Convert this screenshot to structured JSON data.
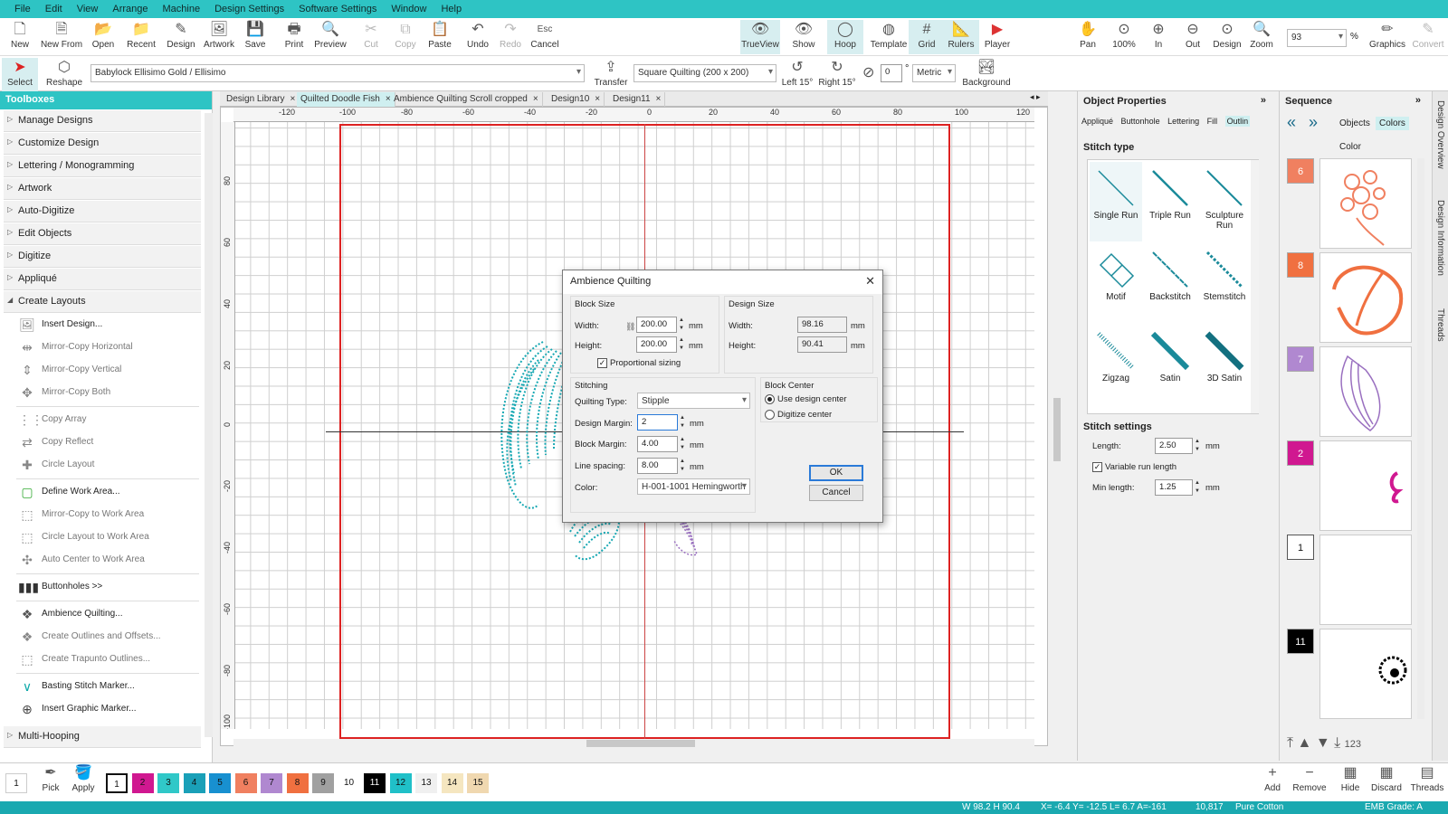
{
  "menu": [
    "File",
    "Edit",
    "View",
    "Arrange",
    "Machine",
    "Design Settings",
    "Software Settings",
    "Window",
    "Help"
  ],
  "toolbar1": {
    "left": [
      "New",
      "New From",
      "Open",
      "Recent",
      "Design",
      "Artwork",
      "Save",
      "Print",
      "Preview",
      "Cut",
      "Copy",
      "Paste",
      "Undo",
      "Redo",
      "Cancel"
    ],
    "middle": [
      "TrueView",
      "Show",
      "Hoop",
      "Template",
      "Grid",
      "Rulers",
      "Player"
    ],
    "right": [
      "Pan",
      "100%",
      "In",
      "Out",
      "Design",
      "Zoom"
    ],
    "zoom_value": "93",
    "zoom_unit": "%",
    "far_right": [
      "Graphics",
      "Convert"
    ]
  },
  "toolbar2": {
    "select": "Select",
    "reshape": "Reshape",
    "machine": "Babylock Ellisimo Gold / Ellisimo",
    "transfer": "Transfer",
    "hoop": "Square Quilting (200 x 200)",
    "left15": "Left 15°",
    "right15": "Right 15°",
    "angle": "0",
    "degree": "°",
    "units": "Metric",
    "background": "Background"
  },
  "toolboxes": {
    "title": "Toolboxes",
    "groups_top": [
      "Manage Designs",
      "Customize Design",
      "Lettering / Monogramming",
      "Artwork",
      "Auto-Digitize",
      "Edit Objects",
      "Digitize",
      "Appliqué"
    ],
    "open_group": "Create Layouts",
    "items": [
      {
        "label": "Insert Design...",
        "dim": false
      },
      {
        "label": "Mirror-Copy Horizontal",
        "dim": true
      },
      {
        "label": "Mirror-Copy Vertical",
        "dim": true
      },
      {
        "label": "Mirror-Copy Both",
        "dim": true
      },
      {
        "label": "Copy Array",
        "dim": true
      },
      {
        "label": "Copy Reflect",
        "dim": true
      },
      {
        "label": "Circle Layout",
        "dim": true
      },
      {
        "label": "Define Work Area...",
        "dim": false
      },
      {
        "label": "Mirror-Copy to Work Area",
        "dim": true
      },
      {
        "label": "Circle Layout to Work Area",
        "dim": true
      },
      {
        "label": "Auto Center to Work Area",
        "dim": true
      },
      {
        "label": "Buttonholes >>",
        "dim": false
      },
      {
        "label": "Ambience Quilting...",
        "dim": false
      },
      {
        "label": "Create Outlines and Offsets...",
        "dim": true
      },
      {
        "label": "Create Trapunto Outlines...",
        "dim": true
      },
      {
        "label": "Basting Stitch Marker...",
        "dim": false
      },
      {
        "label": "Insert Graphic Marker...",
        "dim": false
      }
    ],
    "bottom_group": "Multi-Hooping"
  },
  "tabs": [
    "Design Library",
    "Quilted Doodle Fish",
    "Ambience Quilting Scroll cropped",
    "Design10",
    "Design11"
  ],
  "ruler_top": [
    "-120",
    "-100",
    "-80",
    "-60",
    "-40",
    "-20",
    "0",
    "20",
    "40",
    "60",
    "80",
    "100",
    "120"
  ],
  "ruler_left": [
    "80",
    "60",
    "40",
    "20",
    "0",
    "-20",
    "-40",
    "-60",
    "-80",
    "-100"
  ],
  "dialog": {
    "title": "Ambience Quilting",
    "block_size": {
      "label": "Block Size",
      "width_label": "Width:",
      "width": "200.00",
      "height_label": "Height:",
      "height": "200.00",
      "unit": "mm",
      "proportional": "Proportional sizing"
    },
    "design_size": {
      "label": "Design Size",
      "width_label": "Width:",
      "width": "98.16",
      "height_label": "Height:",
      "height": "90.41",
      "unit": "mm"
    },
    "stitching": {
      "label": "Stitching",
      "type_label": "Quilting Type:",
      "type": "Stipple",
      "design_margin_label": "Design Margin:",
      "design_margin": "2",
      "block_margin_label": "Block Margin:",
      "block_margin": "4.00",
      "line_spacing_label": "Line spacing:",
      "line_spacing": "8.00",
      "color_label": "Color:",
      "color": "H-001-1001 Hemingworth",
      "unit": "mm"
    },
    "block_center": {
      "label": "Block Center",
      "opt1": "Use design center",
      "opt2": "Digitize center"
    },
    "ok": "OK",
    "cancel": "Cancel"
  },
  "object_properties": {
    "title": "Object Properties",
    "tabs": [
      "Appliqué",
      "Buttonhole",
      "Lettering",
      "Fill",
      "Outlin"
    ],
    "stitch_type_label": "Stitch type",
    "stitch_types": [
      "Single Run",
      "Triple Run",
      "Sculpture Run",
      "Motif",
      "Backstitch",
      "Stemstitch",
      "Zigzag",
      "Satin",
      "3D Satin"
    ],
    "stitch_settings_label": "Stitch settings",
    "length_label": "Length:",
    "length": "2.50",
    "variable_run": "Variable run length",
    "min_length_label": "Min length:",
    "min_length": "1.25",
    "unit": "mm"
  },
  "sequence": {
    "title": "Sequence",
    "tabs": [
      "Objects",
      "Colors"
    ],
    "color_label": "Color",
    "rows": [
      {
        "num": "6",
        "color": "#f08060"
      },
      {
        "num": "8",
        "color": "#f07040"
      },
      {
        "num": "7",
        "color": "#b088d0"
      },
      {
        "num": "2",
        "color": "#d01890"
      },
      {
        "num": "1",
        "color": "#ffffff"
      },
      {
        "num": "11",
        "color": "#000000"
      }
    ],
    "counter": "123"
  },
  "side_rail": [
    "Design Overview",
    "Design Information",
    "Threads"
  ],
  "bottom": {
    "first": "1",
    "pick": "Pick",
    "apply": "Apply",
    "swatches": [
      {
        "n": "1",
        "c": "#ffffff"
      },
      {
        "n": "2",
        "c": "#d01890"
      },
      {
        "n": "3",
        "c": "#30c8c8"
      },
      {
        "n": "4",
        "c": "#1aa0b8"
      },
      {
        "n": "5",
        "c": "#1890d0"
      },
      {
        "n": "6",
        "c": "#f08060"
      },
      {
        "n": "7",
        "c": "#b088d0"
      },
      {
        "n": "8",
        "c": "#f07040"
      },
      {
        "n": "9",
        "c": "#a0a0a0"
      },
      {
        "n": "10",
        "c": "#ffffff"
      },
      {
        "n": "11",
        "c": "#000000"
      },
      {
        "n": "12",
        "c": "#20c0c8"
      },
      {
        "n": "13",
        "c": "#f0f0f0"
      },
      {
        "n": "14",
        "c": "#f5e6c0"
      },
      {
        "n": "15",
        "c": "#f0d8b0"
      }
    ],
    "right": [
      "Add",
      "Remove",
      "Hide",
      "Discard",
      "Threads"
    ]
  },
  "status": {
    "size": "W 98.2 H 90.4",
    "coords": "X= -6.4 Y= -12.5  L= 6.7 A=-161",
    "stitches": "10,817",
    "fabric": "Pure Cotton",
    "emb": "EMB Grade: A"
  }
}
